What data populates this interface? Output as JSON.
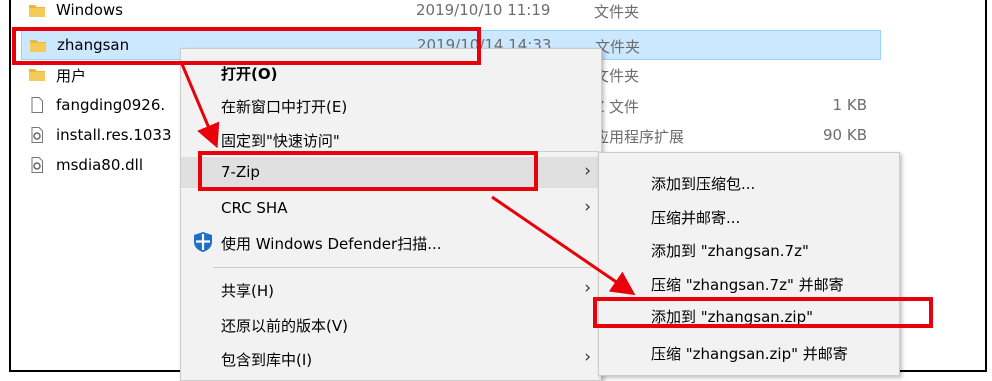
{
  "file_list": [
    {
      "name": "Windows",
      "date": "2019/10/10 11:19",
      "type": "文件夹",
      "size": "",
      "icon": "folder-icon"
    },
    {
      "name": "zhangsan",
      "date": "2019/10/14 14:33",
      "type": "文件夹",
      "size": "",
      "icon": "folder-icon",
      "selected": true
    },
    {
      "name": "用户",
      "date": "",
      "type": "文件夹",
      "size": "",
      "icon": "folder-icon"
    },
    {
      "name": "fangding0926.",
      "date": "",
      "type": "Z 文件",
      "size": "1 KB",
      "icon": "file-icon"
    },
    {
      "name": "install.res.1033",
      "date": "",
      "type": "应用程序扩展",
      "size": "90 KB",
      "icon": "dll-file-icon"
    },
    {
      "name": "msdia80.dll",
      "date": "",
      "type": "",
      "size": "",
      "icon": "dll-file-icon"
    }
  ],
  "context_menu": {
    "items": [
      {
        "label": "打开(O)",
        "bold": true
      },
      {
        "label": "在新窗口中打开(E)"
      },
      {
        "label": "固定到\"快速访问\""
      },
      {
        "label": "7-Zip",
        "has_submenu": true,
        "active": true
      },
      {
        "label": "CRC SHA",
        "has_submenu": true
      },
      {
        "label": "使用 Windows Defender扫描...",
        "icon": "windows-defender-shield-icon"
      },
      {
        "label": "共享(H)",
        "has_submenu": true
      },
      {
        "label": "还原以前的版本(V)"
      },
      {
        "label": "包含到库中(I)",
        "has_submenu": true
      }
    ]
  },
  "submenu_7zip": {
    "items": [
      {
        "label": "添加到压缩包..."
      },
      {
        "label": "压缩并邮寄..."
      },
      {
        "label": "添加到 \"zhangsan.7z\""
      },
      {
        "label": "压缩 \"zhangsan.7z\" 并邮寄"
      },
      {
        "label": "添加到 \"zhangsan.zip\"",
        "highlighted": true
      },
      {
        "label": "压缩 \"zhangsan.zip\" 并邮寄"
      }
    ]
  },
  "annotation_color": "#e8000b",
  "selection_color": "#cce8ff",
  "shield_color": "#1e6fc6"
}
